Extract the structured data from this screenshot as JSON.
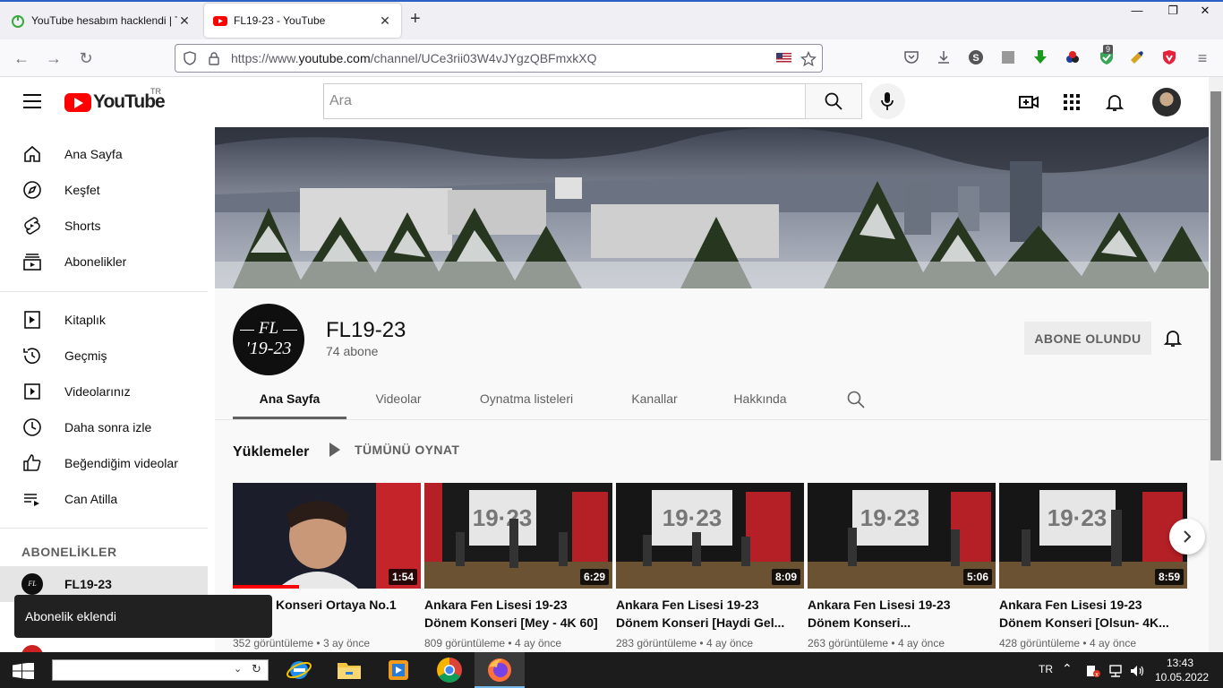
{
  "browser": {
    "tabs": [
      {
        "title": "YouTube hesabım hacklendi | Te",
        "active": false
      },
      {
        "title": "FL19-23 - YouTube",
        "active": true
      }
    ],
    "url_prefix": "https://www.",
    "url_domain": "youtube.com",
    "url_path": "/channel/UCe3rii03W4vJYgzQBFmxkXQ",
    "extension_badge": "9"
  },
  "youtube": {
    "logo_text": "YouTube",
    "region": "TR",
    "search_placeholder": "Ara"
  },
  "sidebar": {
    "items": [
      {
        "label": "Ana Sayfa",
        "icon": "home-icon"
      },
      {
        "label": "Keşfet",
        "icon": "explore-icon"
      },
      {
        "label": "Shorts",
        "icon": "shorts-icon"
      },
      {
        "label": "Abonelikler",
        "icon": "subscriptions-icon"
      }
    ],
    "library": [
      {
        "label": "Kitaplık",
        "icon": "library-icon"
      },
      {
        "label": "Geçmiş",
        "icon": "history-icon"
      },
      {
        "label": "Videolarınız",
        "icon": "your-videos-icon"
      },
      {
        "label": "Daha sonra izle",
        "icon": "watch-later-icon"
      },
      {
        "label": "Beğendiğim videolar",
        "icon": "liked-icon"
      },
      {
        "label": "Can Atilla",
        "icon": "playlist-icon"
      }
    ],
    "subscriptions_heading": "ABONELİKLER",
    "subscriptions": [
      {
        "label": "FL19-23"
      }
    ]
  },
  "channel": {
    "name": "FL19-23",
    "subscribers": "74 abone",
    "avatar_top": "FL",
    "avatar_bottom": "'19-23",
    "subscribe_button": "ABONE OLUNDU",
    "tabs": [
      "Ana Sayfa",
      "Videolar",
      "Oynatma listeleri",
      "Kanallar",
      "Hakkında"
    ],
    "active_tab": 0
  },
  "uploads": {
    "title": "Yüklemeler",
    "play_all": "TÜMÜNÜ OYNAT",
    "videos": [
      {
        "title": "Konseri Ortaya No.1",
        "duration": "1:54",
        "views": "352 görüntüleme",
        "age": "3 ay önce",
        "watched": 0.35
      },
      {
        "title": "Ankara Fen Lisesi 19-23 Dönem Konseri [Mey - 4K 60]",
        "duration": "6:29",
        "views": "809 görüntüleme",
        "age": "4 ay önce"
      },
      {
        "title": "Ankara Fen Lisesi 19-23 Dönem Konseri [Haydi Gel...",
        "duration": "8:09",
        "views": "283 görüntüleme",
        "age": "4 ay önce"
      },
      {
        "title": "Ankara Fen Lisesi 19-23 Dönem Konseri...",
        "duration": "5:06",
        "views": "263 görüntüleme",
        "age": "4 ay önce"
      },
      {
        "title": "Ankara Fen Lisesi 19-23 Dönem Konseri [Olsun- 4K...",
        "duration": "8:59",
        "views": "428 görüntüleme",
        "age": "4 ay önce"
      }
    ]
  },
  "toast": "Abonelik eklendi",
  "taskbar": {
    "language": "TR",
    "time": "13:43",
    "date": "10.05.2022"
  },
  "colors": {
    "youtube_red": "#ff0000",
    "browser_accent": "#2b61c4",
    "taskbar_bg": "#1c1c1c"
  }
}
